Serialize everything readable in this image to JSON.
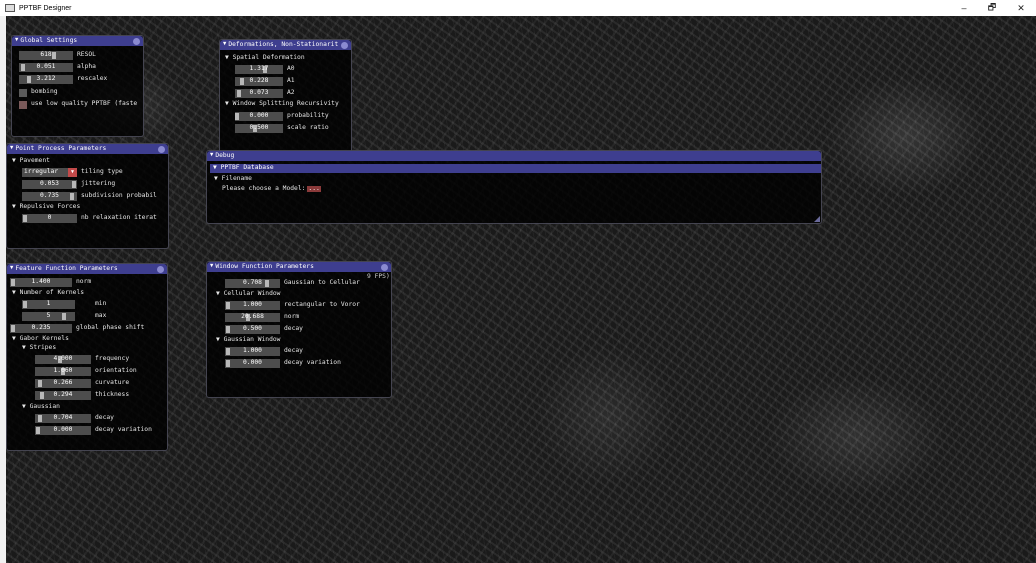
{
  "window": {
    "title": "PPTBF Designer",
    "minimize": "–",
    "maximize": "🗗",
    "close": "✕"
  },
  "global_settings": {
    "title": "Global Settings",
    "resol": {
      "value": "618",
      "label": "RESOL"
    },
    "alpha": {
      "value": "0.051",
      "label": "alpha"
    },
    "rescalex": {
      "value": "3.212",
      "label": "rescalex"
    },
    "bombing_label": "bombing",
    "low_quality_label": "use low quality PPTBF (faste"
  },
  "deformations": {
    "title": "Deformations, Non-Stationarit",
    "spatial_label": "Spatial Deformation",
    "a0": {
      "value": "1.317",
      "label": "A0"
    },
    "a1": {
      "value": "0.228",
      "label": "A1"
    },
    "a2": {
      "value": "0.073",
      "label": "A2"
    },
    "splitting_label": "Window Splitting Recursivity",
    "probability": {
      "value": "0.000",
      "label": "probability"
    },
    "scale_ratio": {
      "value": "0.500",
      "label": "scale ratio"
    }
  },
  "point_process": {
    "title": "Point Process Parameters",
    "pavement_label": "Pavement",
    "tiling": {
      "value": "irregular",
      "label": "tiling type"
    },
    "jittering": {
      "value": "0.053",
      "label": "jittering"
    },
    "subdivision": {
      "value": "0.735",
      "label": "subdivision probabil"
    },
    "repulsive_label": "Repulsive Forces",
    "relaxation": {
      "value": "0",
      "label": "nb relaxation iterat"
    }
  },
  "debug": {
    "title": "Debug",
    "database_label": "PPTBF Database",
    "filename_label": "Filename",
    "choose_text": "Please choose a Model:",
    "browse": "..."
  },
  "feature_function": {
    "title": "Feature Function Parameters",
    "norm": {
      "value": "1.400",
      "label": "norm"
    },
    "kernels_label": "Number of Kernels",
    "min": {
      "value": "1",
      "label": "min"
    },
    "max": {
      "value": "5",
      "label": "max"
    },
    "phase": {
      "value": "0.235",
      "label": "global phase shift"
    },
    "gabor_label": "Gabor Kernels",
    "stripes_label": "Stripes",
    "frequency": {
      "value": "4.000",
      "label": "frequency"
    },
    "orientation": {
      "value": "1.060",
      "label": "orientation"
    },
    "curvature": {
      "value": "0.266",
      "label": "curvature"
    },
    "thickness": {
      "value": "0.294",
      "label": "thickness"
    },
    "gaussian_label": "Gaussian",
    "decay": {
      "value": "0.704",
      "label": "decay"
    },
    "decay_variation": {
      "value": "0.000",
      "label": "decay variation"
    }
  },
  "window_function": {
    "title": "Window Function Parameters",
    "fps_fragment": "9 FPS)",
    "g2c": {
      "value": "0.708",
      "label": "Gaussian to Cellular"
    },
    "cellular_label": "Cellular Window",
    "rect_to_voronoi": {
      "value": "1.000",
      "label": "rectangular to Voror"
    },
    "cell_norm": {
      "value": "20.688",
      "label": "norm"
    },
    "cell_decay": {
      "value": "0.500",
      "label": "decay"
    },
    "gaussian_window_label": "Gaussian Window",
    "gauss_decay": {
      "value": "1.000",
      "label": "decay"
    },
    "gauss_decay_variation": {
      "value": "0.000",
      "label": "decay variation"
    }
  }
}
